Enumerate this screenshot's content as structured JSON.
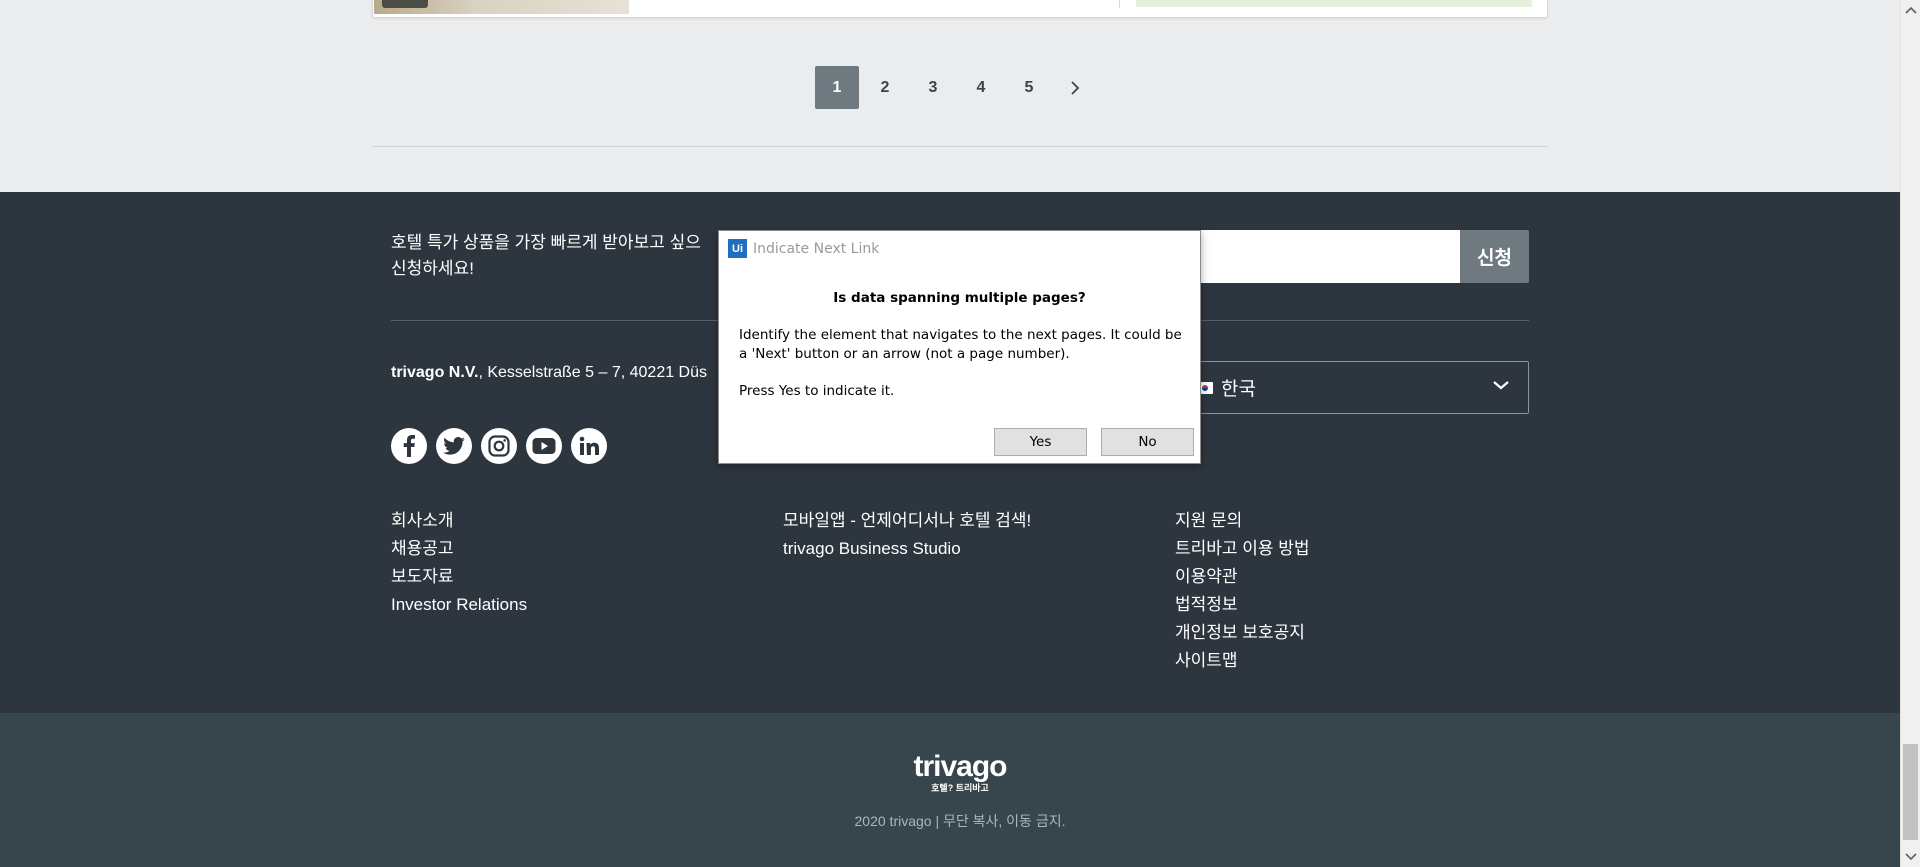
{
  "pagination": {
    "pages": [
      "1",
      "2",
      "3",
      "4",
      "5"
    ],
    "active": "1"
  },
  "newsletter": {
    "text_line1": "호텔 특가 상품을 가장 빠르게 받아보고 싶으",
    "text_line2": "신청하세요!",
    "input_value": "",
    "button_label": "신청"
  },
  "company": {
    "name": "trivago N.V.",
    "address": ", Kesselstraße 5 – 7, 40221 Düs"
  },
  "country_select": {
    "selected": "한국"
  },
  "socials": [
    "facebook-icon",
    "twitter-icon",
    "instagram-icon",
    "youtube-icon",
    "linkedin-icon"
  ],
  "footer_links": {
    "col1": [
      "회사소개",
      "채용공고",
      "보도자료",
      "Investor Relations"
    ],
    "col2": [
      "모바일앱 - 언제어디서나 호텔 검색!",
      "trivago Business Studio"
    ],
    "col3": [
      "지원 문의",
      "트리바고 이용 방법",
      "이용약관",
      "법적정보",
      "개인정보 보호공지",
      "사이트맵"
    ]
  },
  "logo": {
    "word": "trivago",
    "tagline": "호텔? 트리바고"
  },
  "copyright": "2020 trivago | 무단 복사, 이동 금지.",
  "dialog": {
    "logo_text": "Ui",
    "title": "Indicate Next Link",
    "heading": "Is data spanning multiple pages?",
    "body": "Identify the element that navigates to the next pages. It could be a 'Next' button or an arrow (not a page number).",
    "prompt": "Press Yes to indicate it.",
    "yes_label": "Yes",
    "no_label": "No"
  },
  "colors": {
    "footer_bg": "#2d363e",
    "bottom_bar_bg": "#37454d",
    "active_page_bg": "#6f7a80",
    "uipath_blue": "#1e6fbf"
  }
}
